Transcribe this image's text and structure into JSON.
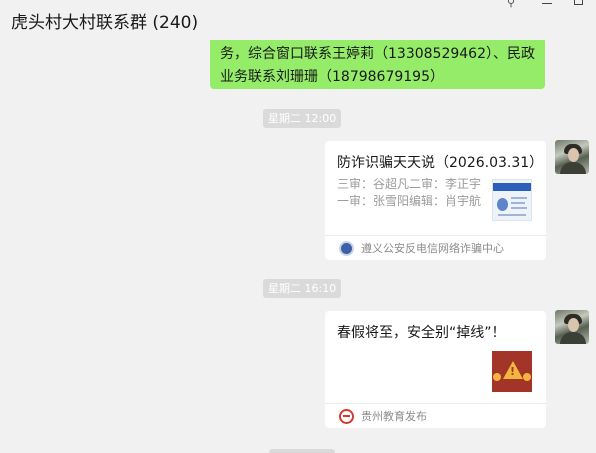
{
  "header": {
    "title": "虎头村大村联系群 (240)",
    "controls": {
      "pin_icon": "pin-icon",
      "minimize_icon": "minimize-icon",
      "maximize_icon": "maximize-icon"
    }
  },
  "messages": {
    "top_bubble": {
      "line1": "务，综合窗口联系王婷莉（13308529462）、民政",
      "line2": "业务联系刘珊珊（18798679195）"
    },
    "time1": "星期二 12:00",
    "card1": {
      "title": "防诈识骗天天说（2026.03.31）",
      "desc1": "三审：谷超凡二审：李正宇",
      "desc2": "一审：张雪阳编辑：肖宇航",
      "source": "遵义公安反电信网络诈骗中心"
    },
    "time2": "星期二 16:10",
    "card2": {
      "title": "春假将至，安全别“掉线”！",
      "source": "贵州教育发布"
    }
  },
  "colors": {
    "sent_bubble": "#95ec69",
    "background": "#f1f1f1",
    "card": "#ffffff",
    "time_pill": "#dadada"
  }
}
